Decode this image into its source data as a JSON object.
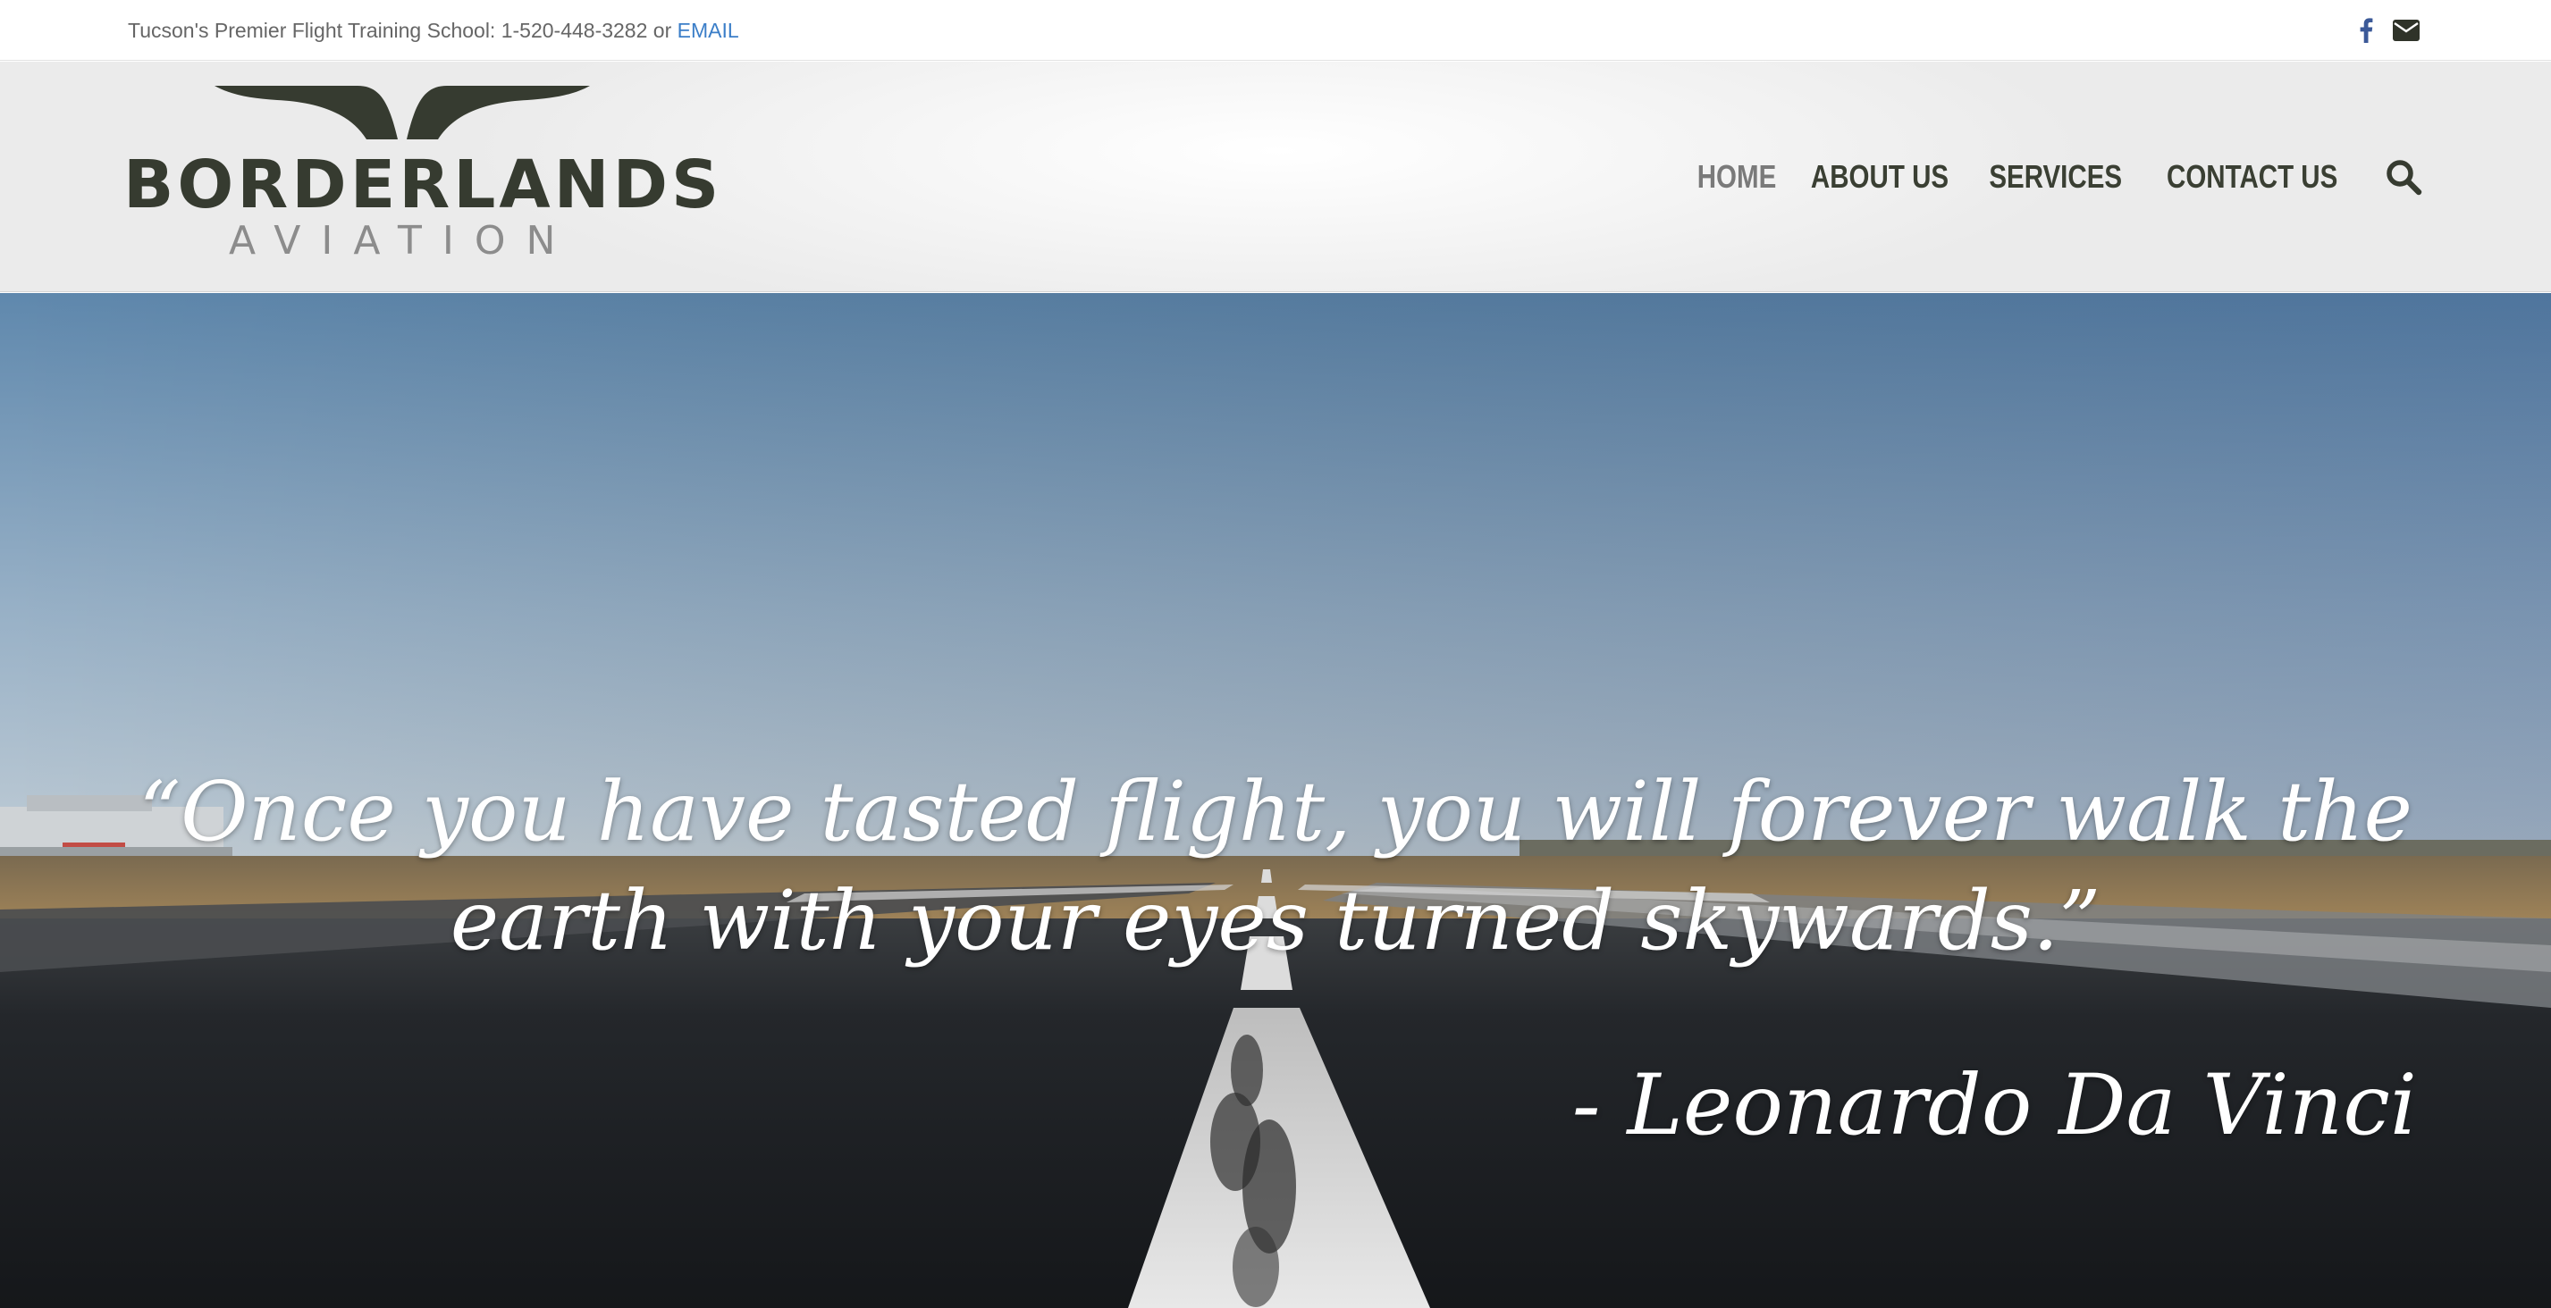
{
  "topbar": {
    "text": "Tucson's Premier Flight Training School: 1-520-448-3282 or ",
    "email_label": "EMAIL",
    "icons": [
      "facebook-icon",
      "envelope-icon"
    ]
  },
  "header": {
    "logo": {
      "word": "BORDERLANDS",
      "sub": "AVIATION"
    },
    "nav": [
      {
        "label": "HOME",
        "active": true
      },
      {
        "label": "ABOUT US",
        "active": false
      },
      {
        "label": "SERVICES",
        "active": false
      },
      {
        "label": "CONTACT US",
        "active": false
      }
    ],
    "search_icon": "search-icon"
  },
  "hero": {
    "quote": "“Once you have tasted flight, you will forever walk the earth with your eyes turned skywards.”",
    "attribution": "- Leonardo Da Vinci"
  },
  "colors": {
    "nav_text": "#3a3f33",
    "nav_active": "#7a7a7a",
    "link": "#3b7ec8",
    "logo_dark": "#363b30",
    "logo_gray": "#8c8c8c"
  }
}
